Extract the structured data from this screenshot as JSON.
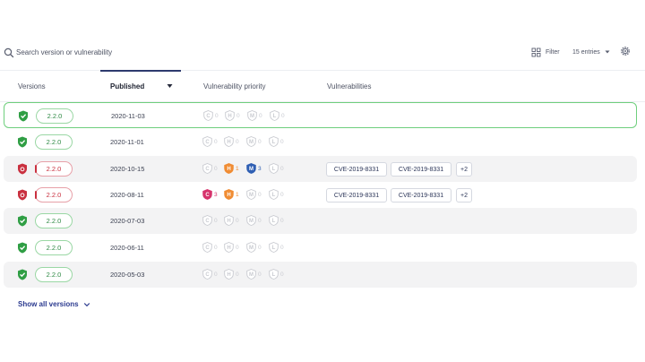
{
  "toolbar": {
    "search_placeholder": "Search version or vulnerability",
    "filter_label": "Filter",
    "entries_label": "15 entries",
    "icons": {
      "search": "search-icon",
      "filter": "filter-icon",
      "entries": "caret-down-icon",
      "settings": "gear-icon"
    }
  },
  "columns": {
    "versions": "Versions",
    "published": "Published",
    "priority": "Vulnerability priority",
    "vulnerabilities": "Vulnerabilities"
  },
  "colors": {
    "ok": "#2f9e44",
    "bad": "#c9303f",
    "critical": "#d6336c",
    "high": "#f08c33",
    "medium": "#2f5fb3",
    "inactive": "#c9cbd1"
  },
  "rows": [
    {
      "version": "2.2.0",
      "status": "ok",
      "date": "2020-11-03",
      "counts": [
        "0",
        "0",
        "0",
        "0"
      ],
      "cves": [],
      "more": ""
    },
    {
      "version": "2.2.0",
      "status": "ok",
      "date": "2020-11-01",
      "counts": [
        "0",
        "0",
        "0",
        "0"
      ],
      "cves": [],
      "more": ""
    },
    {
      "version": "2.2.0",
      "status": "bad",
      "date": "2020-10-15",
      "counts": [
        "0",
        "1",
        "3",
        "0"
      ],
      "cves": [
        "CVE-2019-8331",
        "CVE-2019-8331"
      ],
      "more": "+2"
    },
    {
      "version": "2.2.0",
      "status": "bad",
      "date": "2020-08-11",
      "counts": [
        "3",
        "1",
        "0",
        "0"
      ],
      "cves": [
        "CVE-2019-8331",
        "CVE-2019-8331"
      ],
      "more": "+2"
    },
    {
      "version": "2.2.0",
      "status": "ok",
      "date": "2020-07-03",
      "counts": [
        "0",
        "0",
        "0",
        "0"
      ],
      "cves": [],
      "more": ""
    },
    {
      "version": "2.2.0",
      "status": "ok",
      "date": "2020-06-11",
      "counts": [
        "0",
        "0",
        "0",
        "0"
      ],
      "cves": [],
      "more": ""
    },
    {
      "version": "2.2.0",
      "status": "ok",
      "date": "2020-05-03",
      "counts": [
        "0",
        "0",
        "0",
        "0"
      ],
      "cves": [],
      "more": ""
    }
  ],
  "priority_letters": [
    "C",
    "H",
    "M",
    "L"
  ],
  "footer": {
    "show_all_label": "Show all versions"
  }
}
